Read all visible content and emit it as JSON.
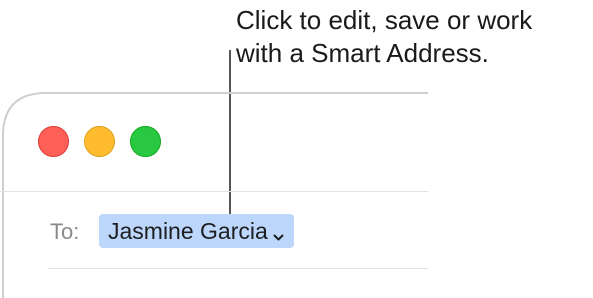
{
  "callout": {
    "line1": "Click to edit, save or work",
    "line2": "with a Smart Address."
  },
  "window": {
    "buttons": {
      "close_color": "#fe5f57",
      "minimize_color": "#febc2e",
      "zoom_color": "#28c840"
    }
  },
  "compose": {
    "to_label": "To:",
    "recipient": {
      "name": "Jasmine Garcia",
      "token_color": "#bcd7fb",
      "icon": "chevron-down-icon"
    }
  }
}
